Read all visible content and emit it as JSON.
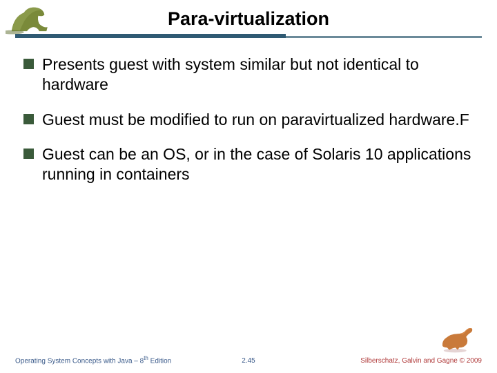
{
  "header": {
    "title": "Para-virtualization"
  },
  "bullets": {
    "item1": "Presents guest with system similar but not identical to hardware",
    "item2": "Guest must be modified to run on paravirtualized hardware.F",
    "item3": "Guest can be an OS, or in the case of Solaris 10 applications running in containers"
  },
  "footer": {
    "left_a": "Operating System Concepts with Java – 8",
    "left_sup": "th",
    "left_b": " Edition",
    "center": "2.45",
    "right": "Silberschatz, Galvin and Gagne © 2009"
  }
}
